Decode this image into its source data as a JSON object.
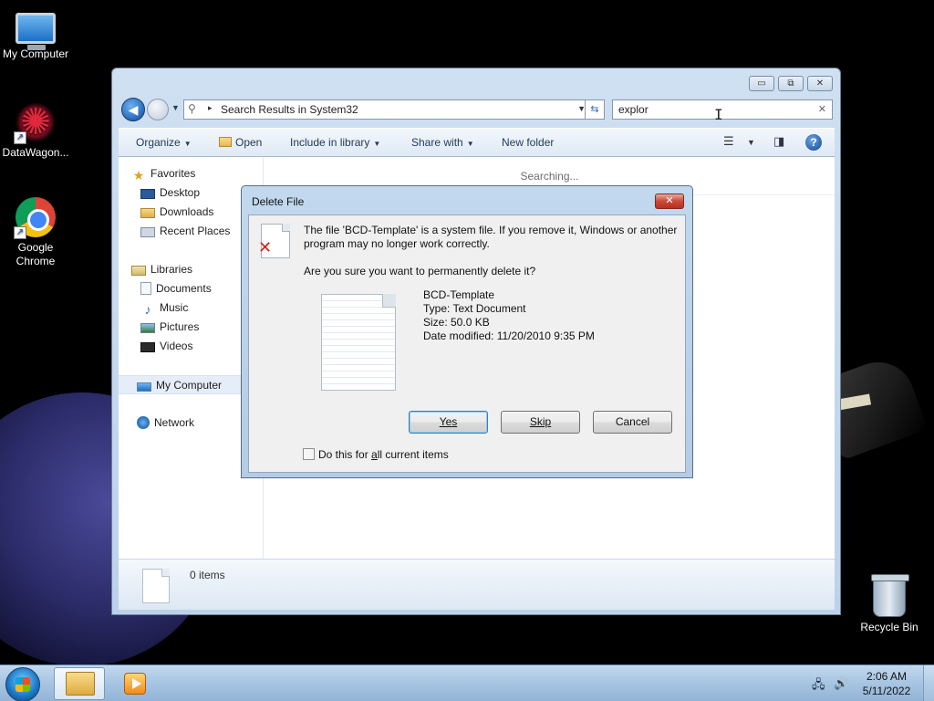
{
  "desktop": {
    "icons": [
      {
        "label": "My Computer",
        "icon": "computer-icon"
      },
      {
        "label": "DataWagon...",
        "icon": "datawagon-icon"
      },
      {
        "label": "Google Chrome",
        "icon": "chrome-icon"
      },
      {
        "label": "Recycle Bin",
        "icon": "recycle-bin-icon"
      }
    ]
  },
  "explorer": {
    "window_controls": {
      "minimize": "▭",
      "maximize": "⧉",
      "close": "✕"
    },
    "address": {
      "separator": "▸",
      "text": "Search Results in System32"
    },
    "search": {
      "value": "explor",
      "clear": "✕"
    },
    "toolbar": {
      "organize": "Organize",
      "open": "Open",
      "include_in_library": "Include in library",
      "share_with": "Share with",
      "new_folder": "New folder"
    },
    "nav": {
      "favorites": "Favorites",
      "desktop": "Desktop",
      "downloads": "Downloads",
      "recent_places": "Recent Places",
      "libraries": "Libraries",
      "documents": "Documents",
      "music": "Music",
      "pictures": "Pictures",
      "videos": "Videos",
      "my_computer": "My Computer",
      "network": "Network"
    },
    "searching_text": "Searching...",
    "details": {
      "count": "0 items"
    }
  },
  "dialog": {
    "title": "Delete File",
    "close": "✕",
    "message": "The file 'BCD-Template' is a system file. If you remove it, Windows or another program may no longer work correctly.",
    "question": "Are you sure you want to permanently delete it?",
    "file": {
      "name": "BCD-Template",
      "type": "Type: Text Document",
      "size": "Size: 50.0 KB",
      "modified": "Date modified: 11/20/2010 9:35 PM"
    },
    "buttons": {
      "yes": "Yes",
      "skip": "Skip",
      "cancel": "Cancel"
    },
    "checkbox": {
      "pre": "Do this for ",
      "underlined": "a",
      "post": "ll current items",
      "checked": false
    }
  },
  "taskbar": {
    "clock_time": "2:06 AM",
    "clock_date": "5/11/2022"
  }
}
